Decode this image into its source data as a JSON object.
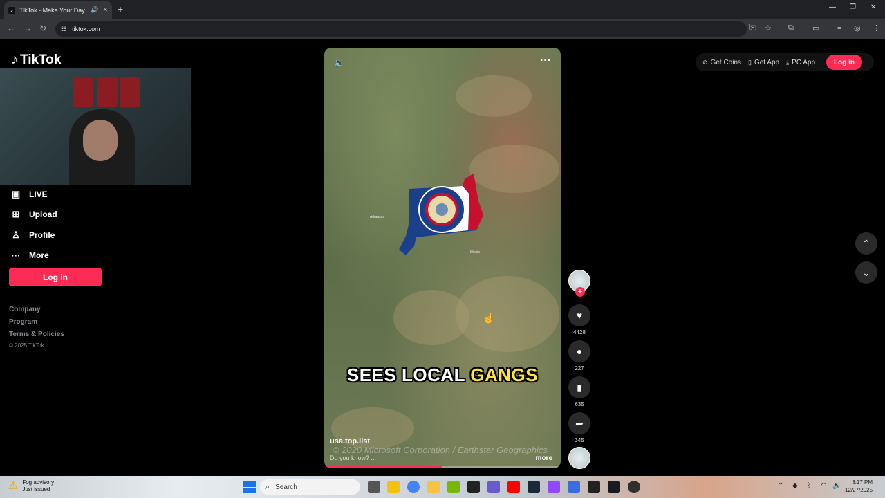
{
  "browser": {
    "tab_title": "TikTok - Make Your Day",
    "url": "tiktok.com"
  },
  "brand": {
    "logo_text": "TikTok"
  },
  "sidebar": {
    "items": [
      {
        "label": "LIVE",
        "icon": "live-icon"
      },
      {
        "label": "Upload",
        "icon": "upload-icon"
      },
      {
        "label": "Profile",
        "icon": "profile-icon"
      },
      {
        "label": "More",
        "icon": "more-icon"
      }
    ],
    "login_label": "Log in",
    "footer_links": [
      "Company",
      "Program",
      "Terms & Policies"
    ],
    "copyright": "© 2025 TikTok"
  },
  "header": {
    "get_coins": "Get Coins",
    "get_app": "Get App",
    "pc_app": "PC App",
    "login": "Log in"
  },
  "video": {
    "caption_white": "SEES LOCAL ",
    "caption_highlight": "GANGS",
    "author": "usa.top.list",
    "description": "Do you know? ...",
    "more_label": "more",
    "watermark": "© 2020 Microsoft Corporation / Earthstar Geographics",
    "map_labels": [
      "Arkansas",
      "Illinois"
    ],
    "progress": 0.5
  },
  "actions": {
    "likes": "4428",
    "comments": "227",
    "saves": "635",
    "shares": "345"
  },
  "taskbar": {
    "weather_line1": "Fog advisory",
    "weather_line2": "Just issued",
    "search_placeholder": "Search",
    "time": "3:17 PM",
    "date": "12/27/2025"
  },
  "colors": {
    "accent": "#fe2c55",
    "highlight": "#ffe53b"
  }
}
